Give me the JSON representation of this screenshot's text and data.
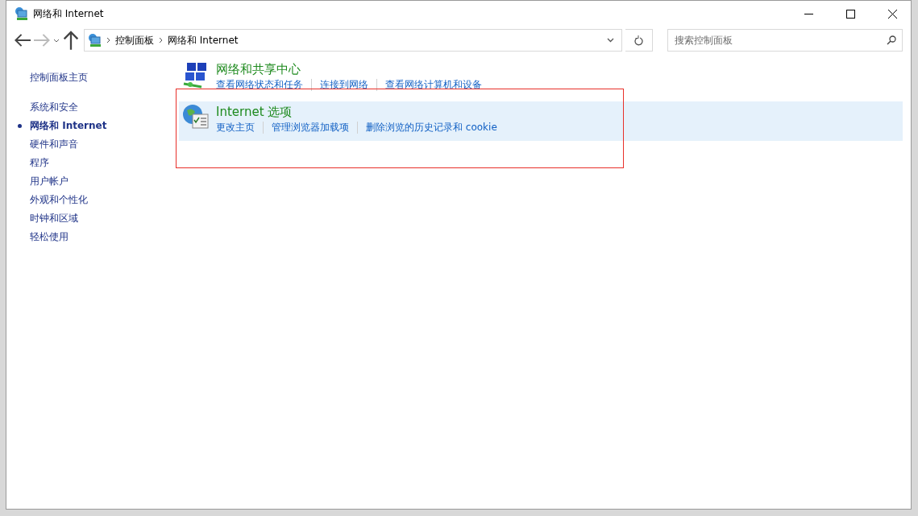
{
  "window": {
    "title": "网络和 Internet"
  },
  "address_bar": {
    "breadcrumbs": [
      "控制面板",
      "网络和 Internet"
    ]
  },
  "search": {
    "placeholder": "搜索控制面板"
  },
  "sidebar": {
    "home": "控制面板主页",
    "items": [
      {
        "label": "系统和安全",
        "selected": false
      },
      {
        "label": "网络和 Internet",
        "selected": true
      },
      {
        "label": "硬件和声音",
        "selected": false
      },
      {
        "label": "程序",
        "selected": false
      },
      {
        "label": "用户帐户",
        "selected": false
      },
      {
        "label": "外观和个性化",
        "selected": false
      },
      {
        "label": "时钟和区域",
        "selected": false
      },
      {
        "label": "轻松使用",
        "selected": false
      }
    ]
  },
  "categories": [
    {
      "kind": "network",
      "title": "网络和共享中心",
      "selected": false,
      "links": [
        "查看网络状态和任务",
        "连接到网络",
        "查看网络计算机和设备"
      ]
    },
    {
      "kind": "internet",
      "title": "Internet 选项",
      "selected": true,
      "links": [
        "更改主页",
        "管理浏览器加载项",
        "删除浏览的历史记录和 cookie"
      ]
    }
  ]
}
